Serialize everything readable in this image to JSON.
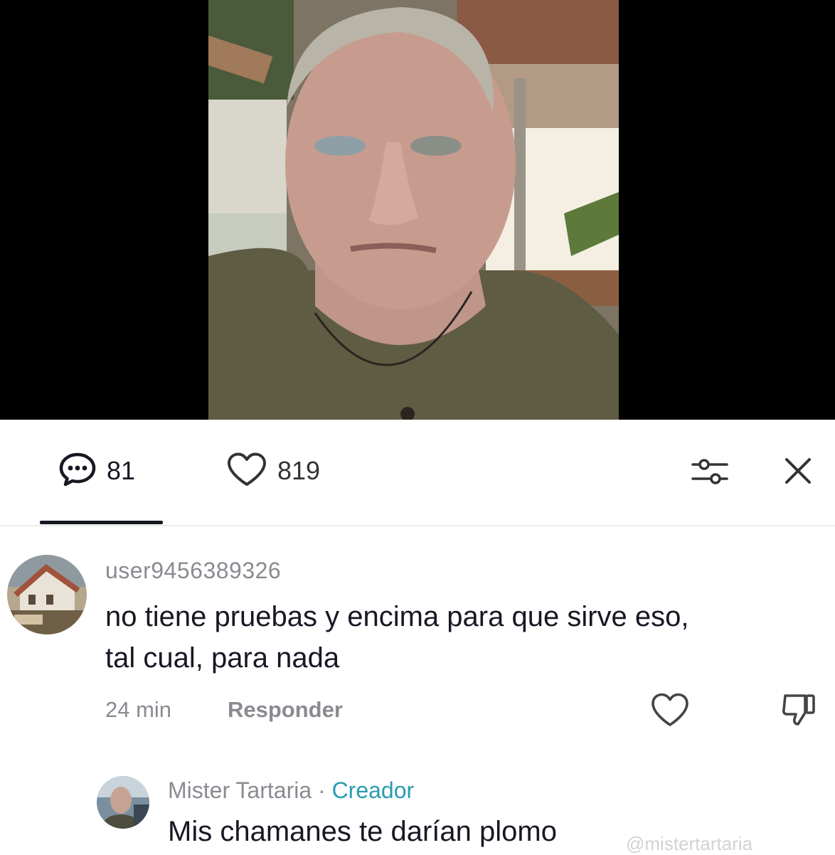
{
  "video": {
    "description_icon": "video-thumbnail"
  },
  "tabs": {
    "comments_icon": "comment-bubble-icon",
    "comments_count": "81",
    "likes_icon": "heart-icon",
    "likes_count": "819",
    "filter_icon": "sliders-icon",
    "close_icon": "close-icon"
  },
  "comments": [
    {
      "username": "user9456389326",
      "text_line1": "no tiene pruebas y encima para que sirve eso,",
      "text_line2": "tal cual, para nada",
      "time": "24 min",
      "reply_label": "Responder",
      "like_icon": "heart-outline-icon",
      "dislike_icon": "thumbs-down-icon"
    }
  ],
  "reply": {
    "author": "Mister Tartaria",
    "separator": " · ",
    "badge": "Creador",
    "text": "Mis chamanes te darían plomo",
    "watermark": "@mistertartaria"
  },
  "colors": {
    "accent_creator": "#2a9bb0",
    "muted_text": "#8a8b91",
    "primary_text": "#161823"
  }
}
